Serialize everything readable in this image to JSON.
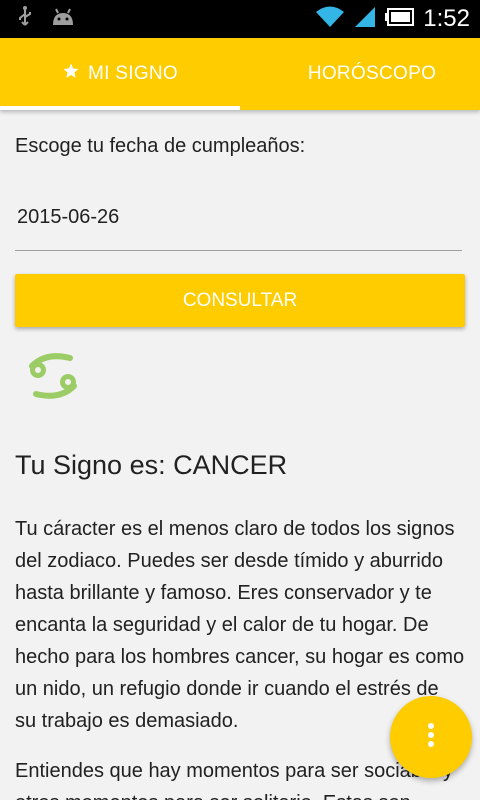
{
  "status_bar": {
    "time": "1:52",
    "icons": [
      "usb-icon",
      "android-icon",
      "wifi-icon",
      "signal-icon",
      "battery-icon"
    ]
  },
  "tabs": [
    {
      "label": "MI SIGNO",
      "icon": "star-icon",
      "selected": true
    },
    {
      "label": "HORÓSCOPO",
      "icon": "moon-icon",
      "selected": false
    }
  ],
  "form": {
    "prompt": "Escoge tu fecha de cumpleaños:",
    "date_value": "2015-06-26",
    "button_label": "CONSULTAR"
  },
  "result": {
    "sign_icon": "cancer-zodiac-icon",
    "title": "Tu Signo es: CANCER",
    "paragraph1": "Tu cáracter es el menos claro de todos los signos del zodiaco. Puedes ser desde tímido y aburrido hasta brillante y famoso. Eres conservador y te encanta la seguridad y el calor de tu hogar. De hecho para los hombres cancer, su hogar es como un nido, un refugio donde ir cuando el estrés de su trabajo es demasiado.",
    "paragraph2": "Entiendes que hay momentos para ser sociable y otros momentos para ser solitario. Estas son"
  },
  "fab": {
    "icon": "more-vert-icon"
  },
  "colors": {
    "accent": "#ffcc00",
    "background": "#f2f2f2",
    "sign_icon": "#9ccc65"
  }
}
